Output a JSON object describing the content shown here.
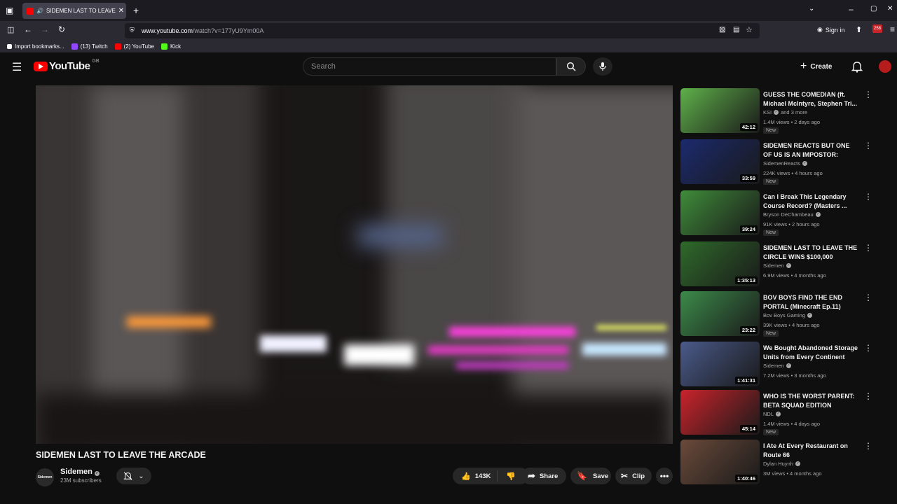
{
  "browser": {
    "tab_title": "SIDEMEN LAST TO LEAVE THE ARCADE",
    "url_host": "www.youtube.com",
    "url_path": "/watch?v=177yU9Ym00A",
    "sign_in": "Sign in",
    "bookmarks": [
      {
        "label": "Import bookmarks...",
        "icon": "import-icon"
      },
      {
        "label": "(13) Twitch",
        "icon": "twitch-icon",
        "color": "#9146ff"
      },
      {
        "label": "(2) YouTube",
        "icon": "youtube-icon",
        "color": "#ff0000"
      },
      {
        "label": "Kick",
        "icon": "kick-icon",
        "color": "#53fc18"
      }
    ]
  },
  "header": {
    "logo_text": "YouTube",
    "region": "GB",
    "search_placeholder": "Search",
    "create_label": "Create"
  },
  "video": {
    "title": "SIDEMEN LAST TO LEAVE THE ARCADE",
    "channel": "Sidemen",
    "subscribers": "23M subscribers",
    "likes": "143K",
    "share_label": "Share",
    "save_label": "Save",
    "clip_label": "Clip"
  },
  "recommendations": [
    {
      "title": "GUESS THE COMEDIAN (ft. Michael McIntyre, Stephen Tri...",
      "channel": "KSI",
      "extra": "and 3 more",
      "meta": "1.4M views • 2 days ago",
      "duration": "42:12",
      "new": "New",
      "thumb_color": "#5fb04a"
    },
    {
      "title": "SIDEMEN REACTS BUT ONE OF US IS AN IMPOSTOR: TIKTOK ...",
      "channel": "SidemenReacts",
      "meta": "224K views • 4 hours ago",
      "duration": "33:59",
      "new": "New",
      "thumb_color": "#1b2a6e"
    },
    {
      "title": "Can I Break This Legendary Course Record? (Masters ...",
      "channel": "Bryson DeChambeau",
      "meta": "91K views • 2 hours ago",
      "duration": "39:24",
      "new": "New",
      "thumb_color": "#3f8c3a"
    },
    {
      "title": "SIDEMEN LAST TO LEAVE THE CIRCLE WINS $100,000",
      "channel": "Sidemen",
      "meta": "6.9M views • 4 months ago",
      "duration": "1:35:13",
      "new": "",
      "thumb_color": "#2f6a2b"
    },
    {
      "title": "BOV BOYS FIND THE END PORTAL (Minecraft Ep.11)",
      "channel": "Bov Boys Gaming",
      "meta": "39K views • 4 hours ago",
      "duration": "23:22",
      "new": "New",
      "thumb_color": "#3c8a4a"
    },
    {
      "title": "We Bought Abandoned Storage Units from Every Continent an...",
      "channel": "Sidemen",
      "meta": "7.2M views • 3 months ago",
      "duration": "1:41:31",
      "new": "",
      "thumb_color": "#4a5a8a"
    },
    {
      "title": "WHO IS THE WORST PARENT: BETA SQUAD EDITION",
      "channel": "NDL",
      "meta": "1.4M views • 4 days ago",
      "duration": "45:14",
      "new": "New",
      "thumb_color": "#c9232b"
    },
    {
      "title": "I Ate At Every Restaurant on Route 66",
      "channel": "Dylan Huynh",
      "meta": "3M views • 4 months ago",
      "duration": "1:40:46",
      "new": "",
      "thumb_color": "#6a4a3a"
    }
  ]
}
